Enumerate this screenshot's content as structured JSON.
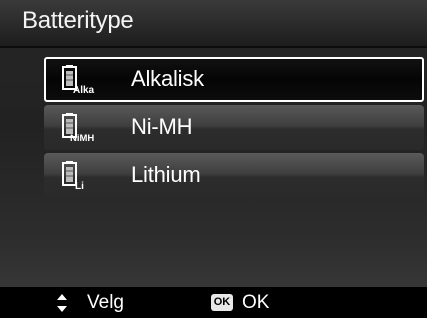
{
  "title": "Batteritype",
  "options": [
    {
      "label": "Alkalisk",
      "icon": "battery-alka-icon",
      "icon_text": "Alka",
      "selected": true
    },
    {
      "label": "Ni-MH",
      "icon": "battery-nimh-icon",
      "icon_text": "NiMH",
      "selected": false
    },
    {
      "label": "Lithium",
      "icon": "battery-lithium-icon",
      "icon_text": "Li",
      "selected": false
    }
  ],
  "footer": {
    "navigate_label": "Velg",
    "ok_badge": "OK",
    "ok_label": "OK"
  }
}
